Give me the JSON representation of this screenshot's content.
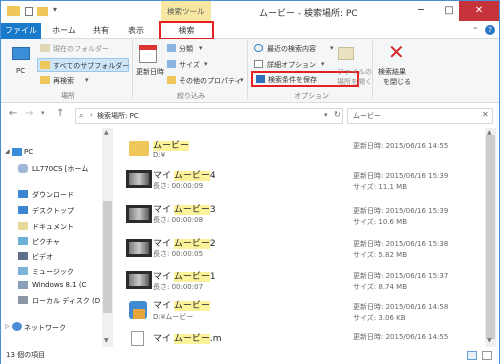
{
  "window": {
    "title": "ムービー - 検索場所: PC",
    "context_tab": "検索ツール",
    "controls": [
      "─",
      "□",
      "✕"
    ]
  },
  "tabs": [
    "ファイル",
    "ホーム",
    "共有",
    "表示",
    "検索"
  ],
  "ribbon": {
    "location": {
      "pc": "PC",
      "current_folder": "現在のフォルダー",
      "all_subfolders": "すべてのサブフォルダー",
      "search_again": "再検索",
      "label": "場所"
    },
    "refine": {
      "date_modified": "更新日時",
      "kind": "分類",
      "size": "サイズ",
      "other_properties": "その他のプロパティ",
      "label": "絞り込み"
    },
    "options": {
      "recent_searches": "最近の検索内容",
      "advanced_options": "詳細オプション",
      "save_search": "検索条件を保存",
      "open_file_location_1": "ファイルの",
      "open_file_location_2": "場所を開く",
      "label": "オプション"
    },
    "close": {
      "line1": "検索結果",
      "line2": "を閉じる"
    }
  },
  "address": {
    "path": "検索場所: PC",
    "search_placeholder": "ムービー"
  },
  "nav": [
    "PC",
    "LL770CS [ホーム",
    "ダウンロード",
    "デスクトップ",
    "ドキュメント",
    "ピクチャ",
    "ビデオ",
    "ミュージック",
    "Windows 8.1 (C",
    "ローカル ディスク (D",
    "ネットワーク"
  ],
  "results": [
    {
      "name_pre": "",
      "name_hl": "ムービー",
      "name_post": "",
      "sub": "D:¥",
      "modified": "更新日時: 2015/06/16 14:55",
      "size": "",
      "type": "folder"
    },
    {
      "name_pre": "マイ ",
      "name_hl": "ムービー",
      "name_post": "4",
      "sub": "長さ: 00:00:09",
      "modified": "更新日時: 2015/06/16 15:39",
      "size": "サイズ: 11.1 MB",
      "type": "video"
    },
    {
      "name_pre": "マイ ",
      "name_hl": "ムービー",
      "name_post": "3",
      "sub": "長さ: 00:00:08",
      "modified": "更新日時: 2015/06/16 15:39",
      "size": "サイズ: 10.6 MB",
      "type": "video"
    },
    {
      "name_pre": "マイ ",
      "name_hl": "ムービー",
      "name_post": "2",
      "sub": "長さ: 00:00:05",
      "modified": "更新日時: 2015/06/16 15:38",
      "size": "サイズ: 5.82 MB",
      "type": "video"
    },
    {
      "name_pre": "マイ ",
      "name_hl": "ムービー",
      "name_post": "1",
      "sub": "長さ: 00:00:07",
      "modified": "更新日時: 2015/06/16 15:37",
      "size": "サイズ: 8.74 MB",
      "type": "video"
    },
    {
      "name_pre": "マイ ",
      "name_hl": "ムービー",
      "name_post": "",
      "sub": "D:¥ムービー",
      "modified": "更新日時: 2015/06/16 14:58",
      "size": "サイズ: 3.06 KB",
      "type": "project"
    },
    {
      "name_pre": "マイ ",
      "name_hl": "ムービー",
      "name_post": ".m",
      "sub": "",
      "modified": "更新日時: 2015/06/16 14:55",
      "size": "",
      "type": "file"
    }
  ],
  "status": "13 個の項目"
}
